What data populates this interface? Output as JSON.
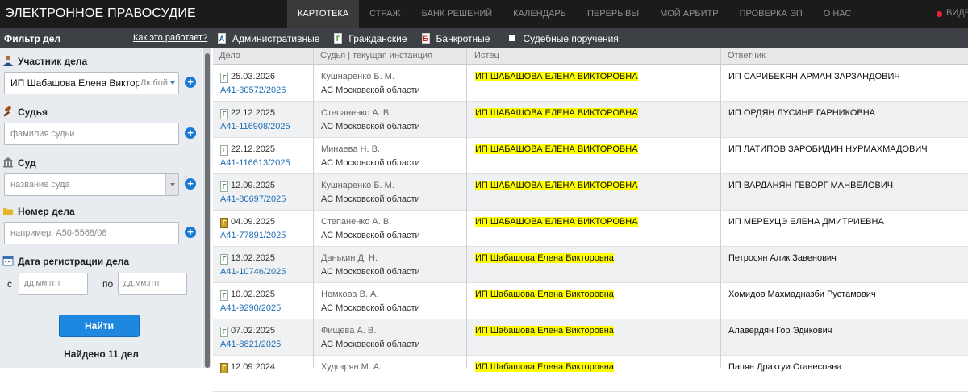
{
  "brand": "ЭЛЕКТРОННОЕ ПРАВОСУДИЕ",
  "nav": [
    "КАРТОТЕКА",
    "СТРАЖ",
    "БАНК РЕШЕНИЙ",
    "КАЛЕНДАРЬ",
    "ПЕРЕРЫВЫ",
    "МОЙ АРБИТР",
    "ПРОВЕРКА ЭП",
    "О НАС"
  ],
  "nav_active": "КАРТОТЕКА",
  "top_right_label": "ВИДЕО",
  "filterbar": {
    "title": "Фильтр дел",
    "how": "Как это работает?",
    "tabs": [
      {
        "badge": "А",
        "label": "Административные"
      },
      {
        "badge": "Г",
        "label": "Гражданские"
      },
      {
        "badge": "Б",
        "label": "Банкротные"
      },
      {
        "badge": "",
        "label": "Судебные поручения"
      }
    ]
  },
  "filters": {
    "participant": {
      "label": "Участник дела",
      "value": "ИП Шабашова Елена Викторовна",
      "role": "Любой"
    },
    "judge": {
      "label": "Судья",
      "placeholder": "фамилия судьи"
    },
    "court": {
      "label": "Суд",
      "placeholder": "название суда"
    },
    "case_number": {
      "label": "Номер дела",
      "placeholder": "например, А50-5568/08"
    },
    "reg_date": {
      "label": "Дата регистрации дела",
      "from_label": "с",
      "to_label": "по",
      "from_placeholder": "дд.мм.гггг",
      "to_placeholder": "дд.мм.гггг"
    },
    "find_button": "Найти",
    "found_text": "Найдено 11 дел"
  },
  "table": {
    "headers": [
      "Дело",
      "Судья | текущая инстанция",
      "Истец",
      "Ответчик"
    ],
    "rows": [
      {
        "icon": "Г",
        "folder": false,
        "date": "25.03.2026",
        "case": "А41-30572/2026",
        "judge": "Кушнаренко Б. М.",
        "court": "АС Московской области",
        "plaintiff": "ИП ШАБАШОВА ЕЛЕНА ВИКТОРОВНА",
        "defendant": "ИП САРИБЕКЯН АРМАН ЗАРЗАНДОВИЧ"
      },
      {
        "icon": "Г",
        "folder": false,
        "date": "22.12.2025",
        "case": "А41-116908/2025",
        "judge": "Степаненко А. В.",
        "court": "АС Московской области",
        "plaintiff": "ИП ШАБАШОВА ЕЛЕНА ВИКТОРОВНА",
        "defendant": "ИП ОРДЯН ЛУСИНЕ ГАРНИКОВНА"
      },
      {
        "icon": "Г",
        "folder": false,
        "date": "22.12.2025",
        "case": "А41-116613/2025",
        "judge": "Минаева Н. В.",
        "court": "АС Московской области",
        "plaintiff": "ИП ШАБАШОВА ЕЛЕНА ВИКТОРОВНА",
        "defendant": "ИП ЛАТИПОВ ЗАРОБИДИН НУРМАХМАДОВИЧ"
      },
      {
        "icon": "Г",
        "folder": false,
        "date": "12.09.2025",
        "case": "А41-80697/2025",
        "judge": "Кушнаренко Б. М.",
        "court": "АС Московской области",
        "plaintiff": "ИП ШАБАШОВА ЕЛЕНА ВИКТОРОВНА",
        "defendant": "ИП ВАРДАНЯН ГЕВОРГ МАНВЕЛОВИЧ"
      },
      {
        "icon": "Г",
        "folder": true,
        "date": "04.09.2025",
        "case": "А41-77891/2025",
        "judge": "Степаненко А. В.",
        "court": "АС Московской области",
        "plaintiff": "ИП ШАБАШОВА ЕЛЕНА ВИКТОРОВНА",
        "defendant": "ИП МЕРЕУЦЭ ЕЛЕНА ДМИТРИЕВНА"
      },
      {
        "icon": "Г",
        "folder": false,
        "date": "13.02.2025",
        "case": "А41-10746/2025",
        "judge": "Данькин Д. Н.",
        "court": "АС Московской области",
        "plaintiff": "ИП Шабашова Елена Викторовна",
        "defendant": "Петросян Алик Завенович"
      },
      {
        "icon": "Г",
        "folder": false,
        "date": "10.02.2025",
        "case": "А41-9290/2025",
        "judge": "Немкова В. А.",
        "court": "АС Московской области",
        "plaintiff": "ИП Шабашова Елена Викторовна",
        "defendant": "Хомидов Махмадназби Рустамович"
      },
      {
        "icon": "Г",
        "folder": false,
        "date": "07.02.2025",
        "case": "А41-8821/2025",
        "judge": "Фищева А. В.",
        "court": "АС Московской области",
        "plaintiff": "ИП Шабашова Елена Викторовна",
        "defendant": "Алавердян Гор Эдикович"
      },
      {
        "icon": "Г",
        "folder": true,
        "date": "12.09.2024",
        "case": "",
        "judge": "Худгарян М. А.",
        "court": "",
        "plaintiff": "ИП Шабашова Елена Викторовна",
        "defendant": "Папян Драхтуи Огане­совна"
      }
    ]
  }
}
